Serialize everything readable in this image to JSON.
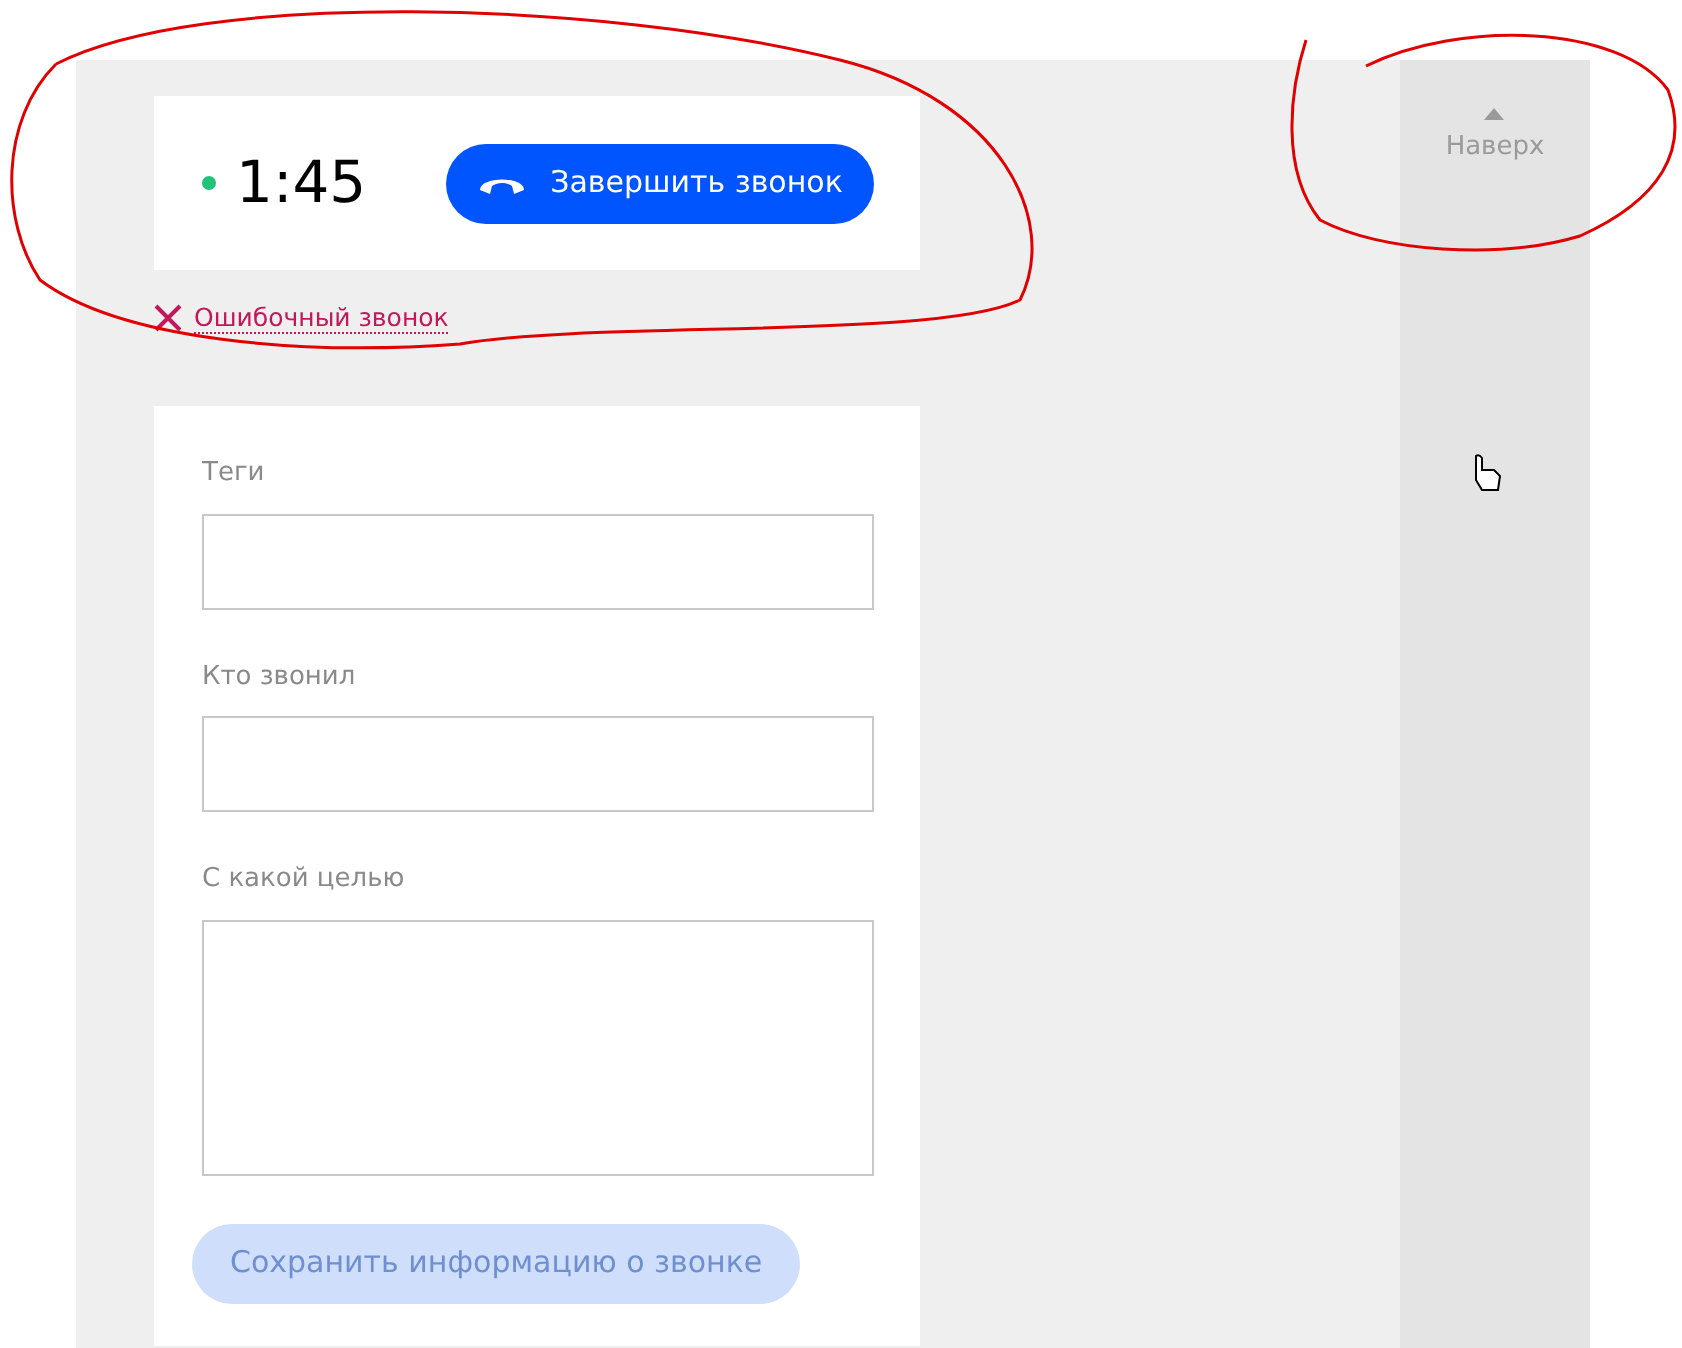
{
  "call": {
    "active": true,
    "timer": "1:45",
    "end_button": "Завершить звонок"
  },
  "mistaken_call_link": "Ошибочный звонок",
  "form": {
    "fields": [
      {
        "label": "Теги",
        "kind": "input"
      },
      {
        "label": "Кто звонил",
        "kind": "input"
      },
      {
        "label": "С какой целью",
        "kind": "textarea"
      }
    ],
    "save_button": {
      "label": "Сохранить информацию о звонке",
      "disabled": true
    }
  },
  "back_to_top": "Наверх"
}
